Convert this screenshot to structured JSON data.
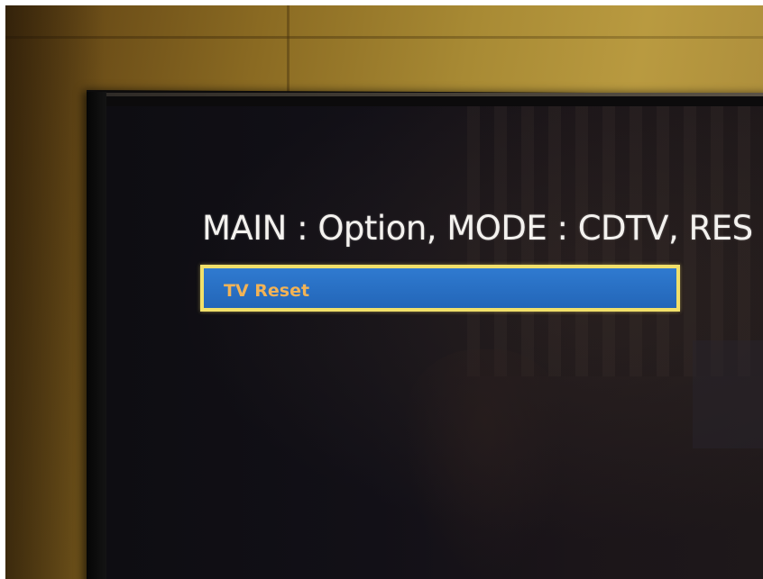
{
  "tv_menu": {
    "header_text": "MAIN : Option, MODE : CDTV, RES",
    "items": [
      {
        "label": "TV Reset",
        "selected": true
      }
    ]
  },
  "colors": {
    "selection_border": "#f1e06a",
    "selection_fill": "#2a6fc4",
    "item_text": "#f2b356",
    "header_text": "#f4f2ef"
  }
}
